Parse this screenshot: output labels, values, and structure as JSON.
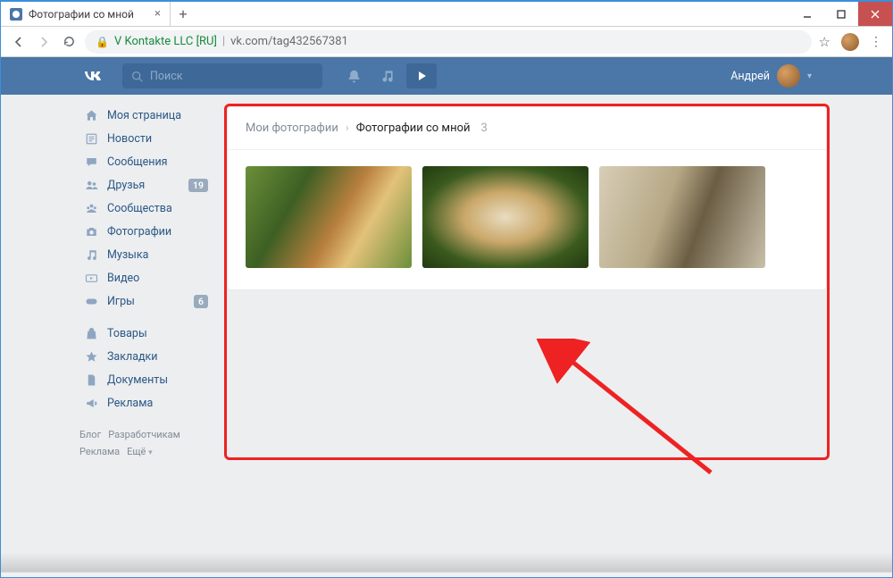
{
  "browser": {
    "tab_title": "Фотографии со мной",
    "address_org": "V Kontakte LLC [RU]",
    "address_url": "vk.com/tag432567381"
  },
  "vk": {
    "search_placeholder": "Поиск",
    "username": "Андрей"
  },
  "sidebar": {
    "items": [
      {
        "label": "Моя страница",
        "badge": null
      },
      {
        "label": "Новости",
        "badge": null
      },
      {
        "label": "Сообщения",
        "badge": null
      },
      {
        "label": "Друзья",
        "badge": "19"
      },
      {
        "label": "Сообщества",
        "badge": null
      },
      {
        "label": "Фотографии",
        "badge": null
      },
      {
        "label": "Музыка",
        "badge": null
      },
      {
        "label": "Видео",
        "badge": null
      },
      {
        "label": "Игры",
        "badge": "6"
      }
    ],
    "items2": [
      {
        "label": "Товары"
      },
      {
        "label": "Закладки"
      },
      {
        "label": "Документы"
      },
      {
        "label": "Реклама"
      }
    ],
    "footer": {
      "blog": "Блог",
      "dev": "Разработчикам",
      "ads": "Реклама",
      "more": "Ещё"
    }
  },
  "breadcrumb": {
    "root": "Мои фотографии",
    "current": "Фотографии со мной",
    "count": "3"
  }
}
